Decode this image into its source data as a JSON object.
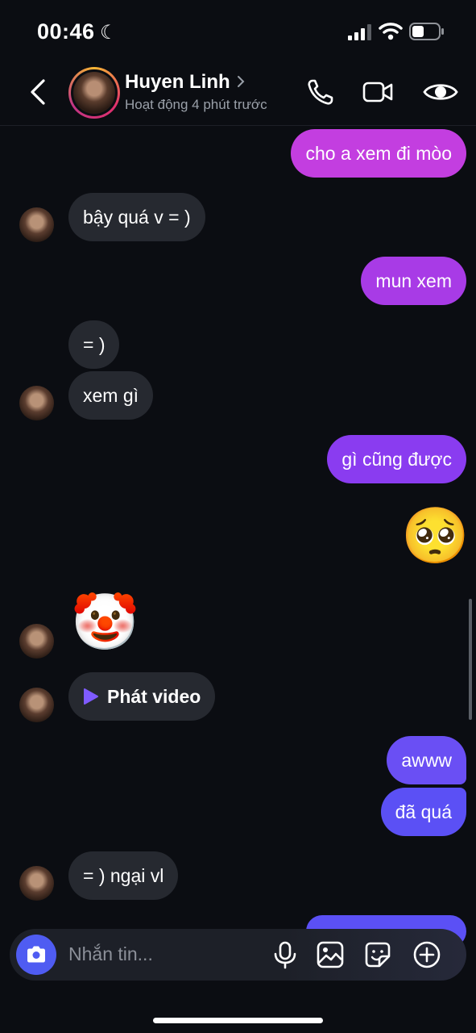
{
  "status_bar": {
    "time": "00:46"
  },
  "header": {
    "name": "Huyen Linh",
    "activity": "Hoạt động 4 phút trước"
  },
  "messages": [
    {
      "from": "me",
      "text": "cho a xem đi mòo"
    },
    {
      "from": "them",
      "text": "bậy quá v = )"
    },
    {
      "from": "me",
      "text": "mun xem"
    },
    {
      "from": "them",
      "text": "= )"
    },
    {
      "from": "them",
      "text": "xem gì"
    },
    {
      "from": "me",
      "text": "gì cũng được"
    },
    {
      "from": "me",
      "text": "🥺"
    },
    {
      "from": "them",
      "text": "🤡"
    },
    {
      "from": "them",
      "text": "Phát video"
    },
    {
      "from": "me",
      "text": "awww"
    },
    {
      "from": "me",
      "text": "đã quá"
    },
    {
      "from": "them",
      "text": "= ) ngại vl"
    }
  ],
  "composer": {
    "placeholder": "Nhắn tin..."
  },
  "colors": {
    "bubble_pink": "#c33ee0",
    "bubble_purple": "#8a3cf0",
    "bubble_blue": "#5b50f5",
    "bubble_in": "#262930"
  }
}
